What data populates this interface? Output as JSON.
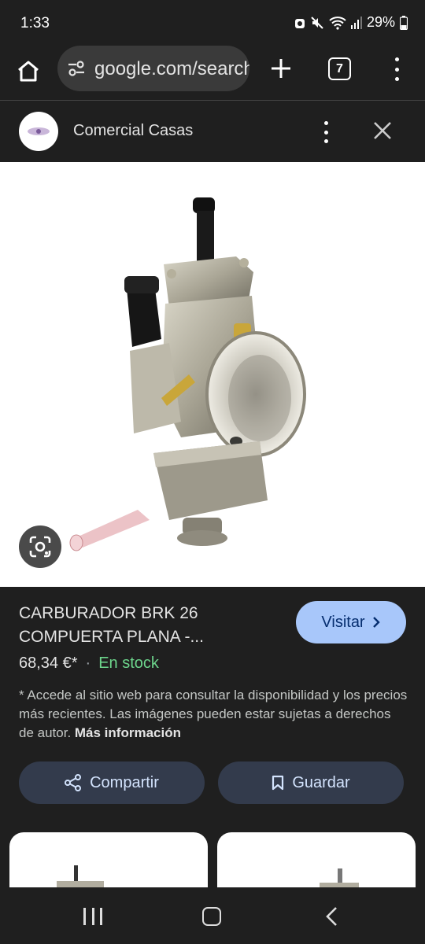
{
  "status_bar": {
    "time": "1:33",
    "battery": "29%"
  },
  "browser": {
    "url": "google.com/search",
    "tab_count": "7"
  },
  "source": {
    "name": "Comercial Casas"
  },
  "product": {
    "title": "CARBURADOR BRK 26 COMPUERTA PLANA -...",
    "price": "68,34 €*",
    "separator": "·",
    "stock": "En stock",
    "disclaimer": "* Accede al sitio web para consultar la disponibilidad y los precios más recientes. Las imágenes pueden estar sujetas a derechos de autor. ",
    "more_info": "Más información"
  },
  "actions": {
    "visit": "Visitar",
    "share": "Compartir",
    "save": "Guardar"
  },
  "colors": {
    "accent": "#a8c7fa",
    "stock_green": "#6dd58c",
    "button_bg": "#333b4c"
  }
}
